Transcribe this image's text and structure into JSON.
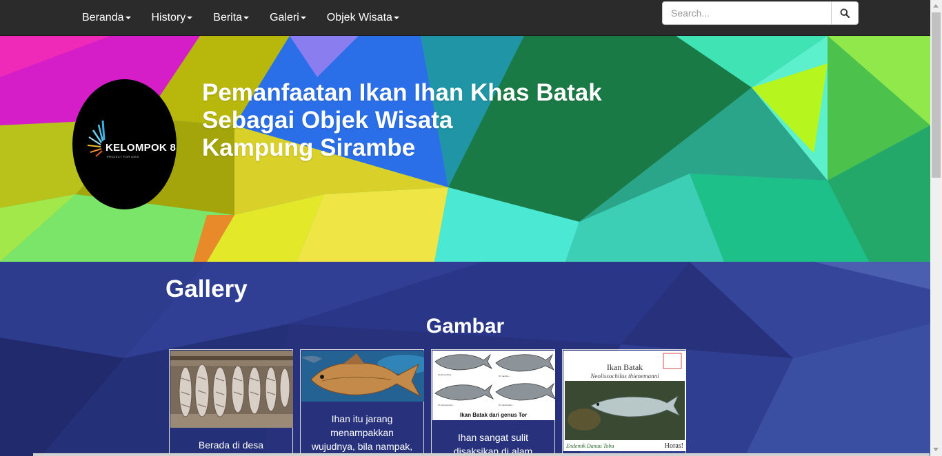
{
  "nav": {
    "items": [
      {
        "label": "Beranda"
      },
      {
        "label": "History"
      },
      {
        "label": "Berita"
      },
      {
        "label": "Galeri"
      },
      {
        "label": "Objek Wisata"
      }
    ],
    "search_placeholder": "Search...",
    "search_icon": "search-icon"
  },
  "hero": {
    "logo_text": "KELOMPOK 8",
    "logo_subtext": "PROJECT FOR IDEA",
    "title_lines": [
      "Pemanfaatan Ikan Ihan Khas Batak",
      "Sebagai Objek Wisata",
      "Kampung Sirambe"
    ]
  },
  "gallery": {
    "title": "Gallery",
    "subtitle": "Gambar",
    "cards": [
      {
        "caption": "Berada di desa"
      },
      {
        "caption": "Ihan itu jarang menampakkan wujudnya, bila nampak,"
      },
      {
        "caption": "Ihan sangat sulit disaksikan di alam",
        "image_caption": "Ikan Batak dari genus Tor"
      },
      {
        "image_title": "Ikan Batak",
        "image_species": "Neolissochilus thienemanni",
        "image_footer_left": "Endemik Danau Toba",
        "image_footer_right": "Horas!"
      }
    ]
  },
  "colors": {
    "navbar": "#2b2b2b",
    "gallery_bg": "#2a3580",
    "text": "#ffffff"
  }
}
